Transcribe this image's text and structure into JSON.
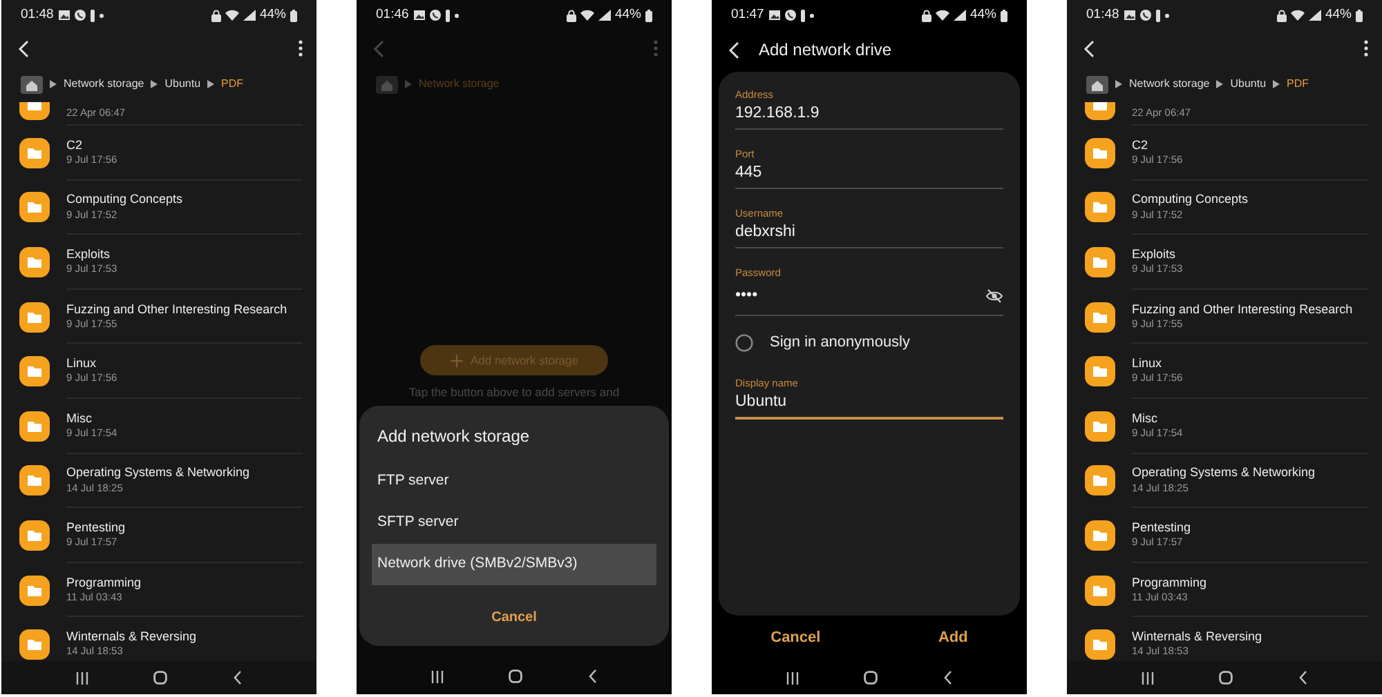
{
  "panels": [
    {
      "kind": "file_list",
      "status_bar": {
        "time": "01:48",
        "battery": "44%"
      },
      "breadcrumb": [
        {
          "label": "Network storage",
          "current": false
        },
        {
          "label": "Ubuntu",
          "current": false
        },
        {
          "label": "PDF",
          "current": true
        }
      ],
      "partial_row": {
        "date": "22 Apr 06:47"
      },
      "folders": [
        {
          "name": "C2",
          "date": "9 Jul 17:56"
        },
        {
          "name": "Computing Concepts",
          "date": "9 Jul 17:52"
        },
        {
          "name": "Exploits",
          "date": "9 Jul 17:53"
        },
        {
          "name": "Fuzzing and Other Interesting Research",
          "date": "9 Jul 17:55"
        },
        {
          "name": "Linux",
          "date": "9 Jul 17:56"
        },
        {
          "name": "Misc",
          "date": "9 Jul 17:54"
        },
        {
          "name": "Operating Systems & Networking",
          "date": "14 Jul 18:25"
        },
        {
          "name": "Pentesting",
          "date": "9 Jul 17:57"
        },
        {
          "name": "Programming",
          "date": "11 Jul 03:43"
        },
        {
          "name": "Winternals & Reversing",
          "date": "14 Jul 18:53"
        }
      ]
    },
    {
      "kind": "storage_dialog",
      "status_bar": {
        "time": "01:46",
        "battery": "44%"
      },
      "breadcrumb": [
        {
          "label": "Network storage",
          "current": true
        }
      ],
      "add_button": "Add network storage",
      "hint": "Tap the button above to add servers and",
      "sheet": {
        "title": "Add network storage",
        "options": [
          {
            "label": "FTP server",
            "selected": false
          },
          {
            "label": "SFTP server",
            "selected": false
          },
          {
            "label": "Network drive (SMBv2/SMBv3)",
            "selected": true
          }
        ],
        "cancel": "Cancel"
      }
    },
    {
      "kind": "drive_form",
      "status_bar": {
        "time": "01:47",
        "battery": "44%"
      },
      "title": "Add network drive",
      "fields": [
        {
          "kind": "text",
          "label": "Address",
          "value": "192.168.1.9",
          "focused": false
        },
        {
          "kind": "text",
          "label": "Port",
          "value": "445",
          "focused": false
        },
        {
          "kind": "text",
          "label": "Username",
          "value": "debxrshi",
          "focused": false
        },
        {
          "kind": "password",
          "label": "Password",
          "value": "••••",
          "focused": false
        },
        {
          "kind": "radio",
          "label": "Sign in anonymously",
          "checked": false
        },
        {
          "kind": "text",
          "label": "Display name",
          "value": "Ubuntu",
          "focused": true
        }
      ],
      "buttons": [
        "Cancel",
        "Add"
      ]
    },
    {
      "kind": "file_list",
      "status_bar": {
        "time": "01:48",
        "battery": "44%"
      },
      "breadcrumb": [
        {
          "label": "Network storage",
          "current": false
        },
        {
          "label": "Ubuntu",
          "current": false
        },
        {
          "label": "PDF",
          "current": true
        }
      ],
      "partial_row": {
        "date": "22 Apr 06:47"
      },
      "folders": [
        {
          "name": "C2",
          "date": "9 Jul 17:56"
        },
        {
          "name": "Computing Concepts",
          "date": "9 Jul 17:52"
        },
        {
          "name": "Exploits",
          "date": "9 Jul 17:53"
        },
        {
          "name": "Fuzzing and Other Interesting Research",
          "date": "9 Jul 17:55"
        },
        {
          "name": "Linux",
          "date": "9 Jul 17:56"
        },
        {
          "name": "Misc",
          "date": "9 Jul 17:54"
        },
        {
          "name": "Operating Systems & Networking",
          "date": "14 Jul 18:25"
        },
        {
          "name": "Pentesting",
          "date": "9 Jul 17:57"
        },
        {
          "name": "Programming",
          "date": "11 Jul 03:43"
        },
        {
          "name": "Winternals & Reversing",
          "date": "14 Jul 18:53"
        }
      ]
    }
  ]
}
